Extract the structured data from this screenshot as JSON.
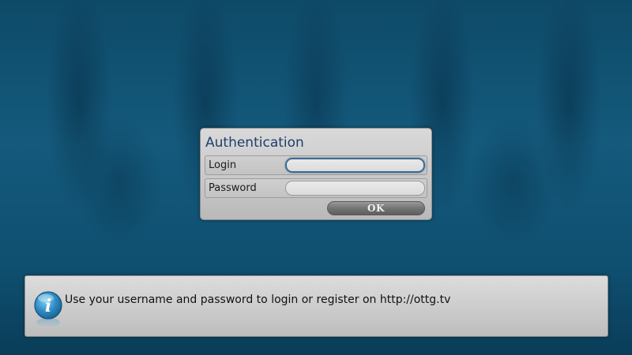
{
  "dialog": {
    "title": "Authentication",
    "login_label": "Login",
    "login_value": "",
    "password_label": "Password",
    "password_value": "",
    "ok_label": "OK"
  },
  "info_bar": {
    "icon": "info-icon",
    "message": "Use your username and password to login or register on http://ottg.tv"
  },
  "colors": {
    "background": "#145a7c",
    "dialog_title": "#1e3e6d",
    "focus_ring": "#3b6a93",
    "info_icon": "#2e8bc4"
  }
}
